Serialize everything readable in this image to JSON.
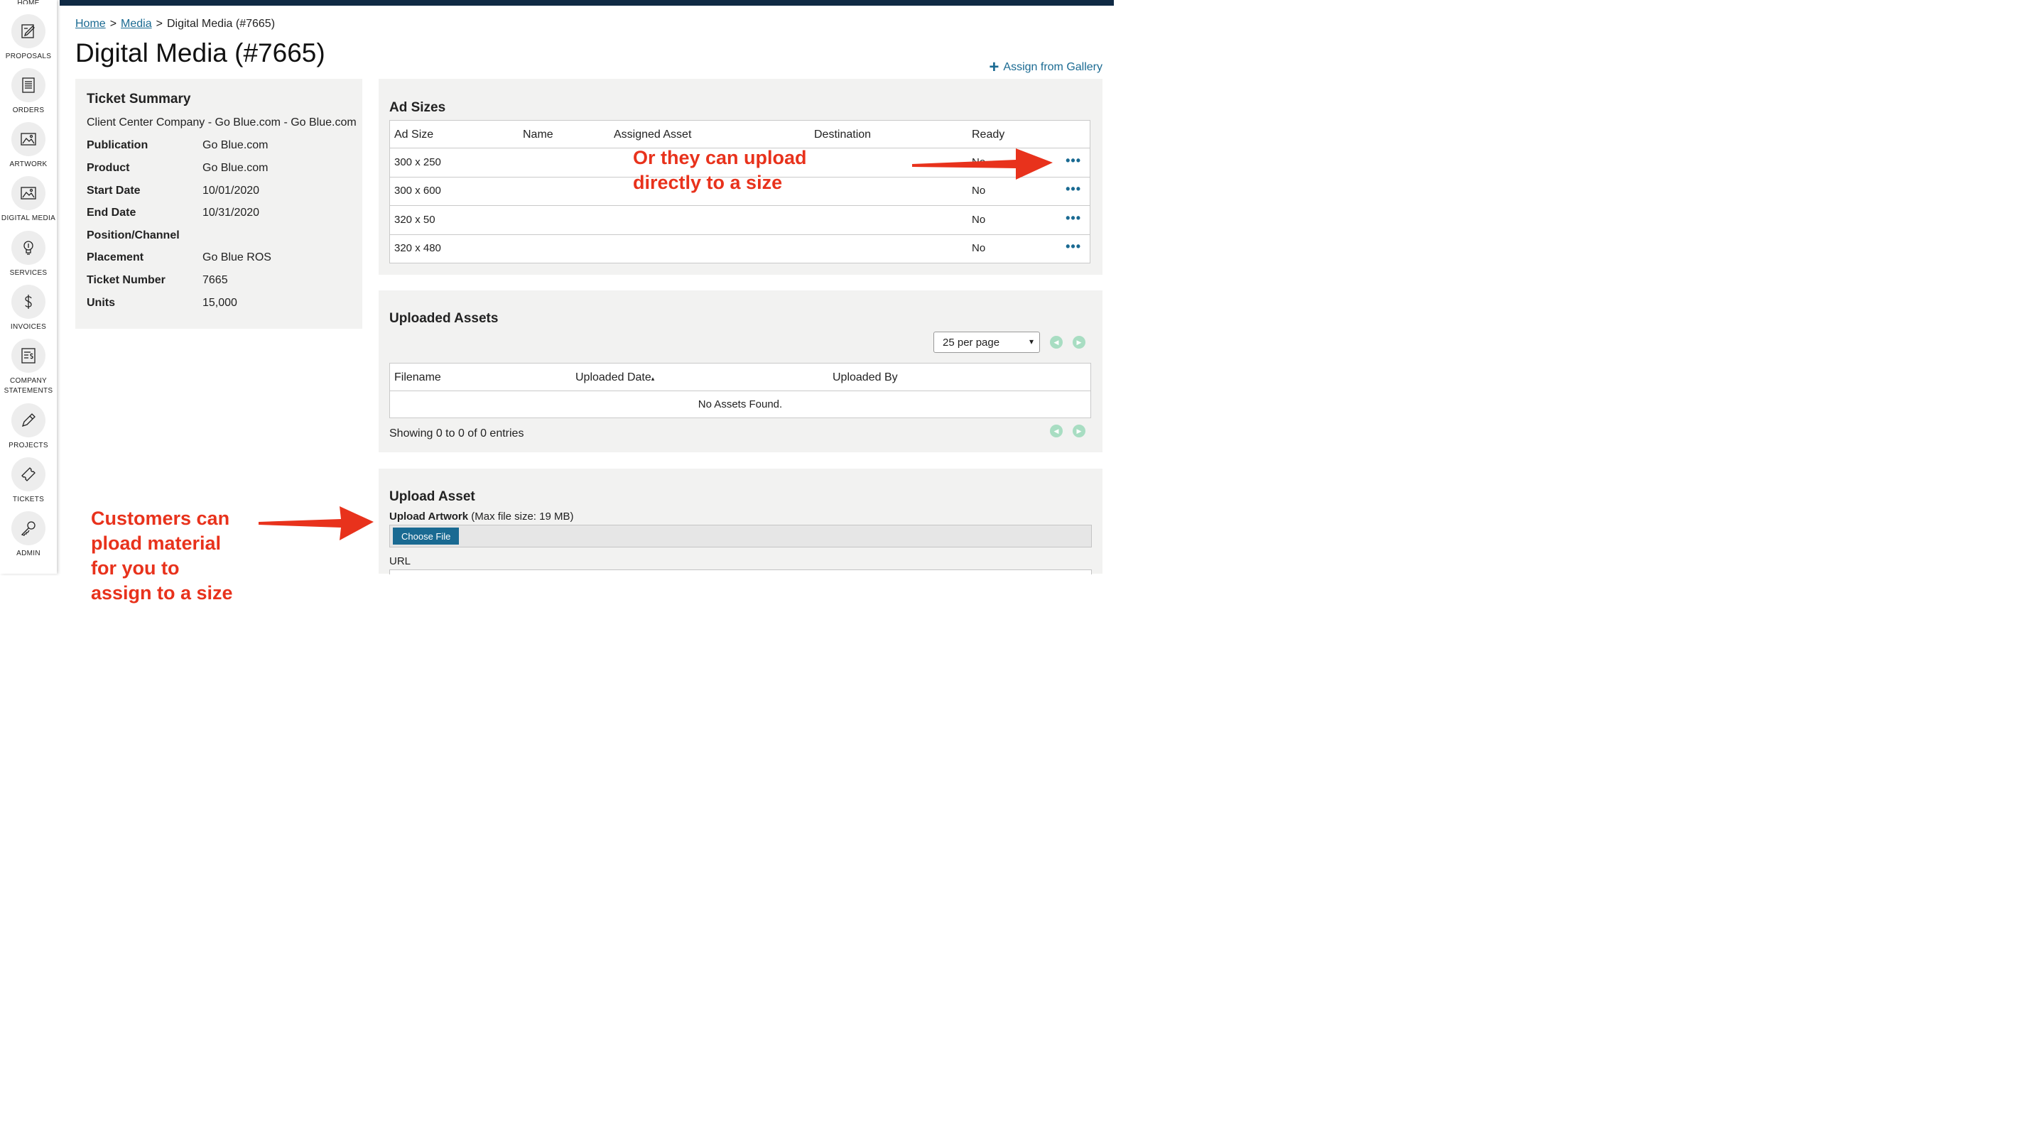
{
  "sidebar": {
    "cut_label": "HOME",
    "items": [
      {
        "label": "PROPOSALS",
        "icon": "proposal-edit-icon"
      },
      {
        "label": "ORDERS",
        "icon": "document-list-icon"
      },
      {
        "label": "ARTWORK",
        "icon": "image-icon"
      },
      {
        "label": "DIGITAL MEDIA",
        "icon": "image-icon"
      },
      {
        "label": "SERVICES",
        "icon": "lightbulb-icon"
      },
      {
        "label": "INVOICES",
        "icon": "dollar-icon"
      },
      {
        "label": "COMPANY",
        "label2": "STATEMENTS",
        "icon": "statement-icon"
      },
      {
        "label": "PROJECTS",
        "icon": "pencil-icon"
      },
      {
        "label": "TICKETS",
        "icon": "ticket-icon"
      },
      {
        "label": "ADMIN",
        "icon": "key-icon"
      }
    ]
  },
  "breadcrumb": {
    "home": "Home",
    "media": "Media",
    "current": "Digital Media (#7665)",
    "sep": ">"
  },
  "page_title": "Digital Media (#7665)",
  "assign_link": "Assign from Gallery",
  "summary": {
    "title": "Ticket Summary",
    "client": "Client Center Company - Go Blue.com - Go Blue.com",
    "rows": [
      {
        "key": "Publication",
        "value": "Go Blue.com"
      },
      {
        "key": "Product",
        "value": "Go Blue.com"
      },
      {
        "key": "Start Date",
        "value": "10/01/2020"
      },
      {
        "key": "End Date",
        "value": "10/31/2020"
      },
      {
        "key": "Position/Channel",
        "value": ""
      },
      {
        "key": "Placement",
        "value": "Go Blue ROS"
      },
      {
        "key": "Ticket Number",
        "value": "7665"
      },
      {
        "key": "Units",
        "value": "15,000"
      }
    ]
  },
  "ad_sizes": {
    "title": "Ad Sizes",
    "columns": [
      "Ad Size",
      "Name",
      "Assigned Asset",
      "Destination",
      "Ready"
    ],
    "rows": [
      {
        "size": "300 x 250",
        "ready": "No"
      },
      {
        "size": "300 x 600",
        "ready": "No"
      },
      {
        "size": "320 x 50",
        "ready": "No"
      },
      {
        "size": "320 x 480",
        "ready": "No"
      }
    ],
    "actions_glyph": "•••"
  },
  "uploaded_assets": {
    "title": "Uploaded Assets",
    "per_page": "25 per page",
    "columns": [
      "Filename",
      "Uploaded Date",
      "Uploaded By"
    ],
    "sort_glyph": "▴",
    "empty": "No Assets Found.",
    "showing": "Showing 0 to 0 of 0 entries"
  },
  "upload_asset": {
    "title": "Upload Asset",
    "label_bold": "Upload Artwork",
    "label_rest": " (Max file size: 19 MB)",
    "choose_file": "Choose File",
    "url_label": "URL"
  },
  "annotations": {
    "top_line1": "Or they can upload",
    "top_line2": "directly to a size",
    "bottom_line1": "Customers can",
    "bottom_line2": "pload material",
    "bottom_line3": "for you to",
    "bottom_line4": "assign to a size"
  },
  "colors": {
    "accent": "#1a6a92",
    "annotation": "#e8321c",
    "topbar": "#0f2a44",
    "pager": "#a8ddc2"
  }
}
